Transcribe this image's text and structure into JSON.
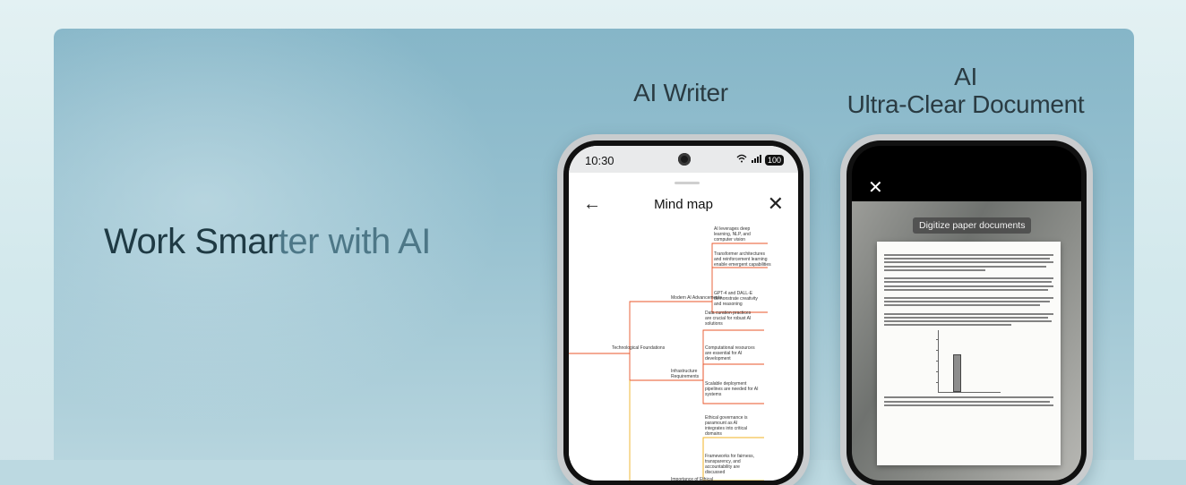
{
  "banner": {
    "headline_main": "Work Smar",
    "headline_accent": "ter with AI"
  },
  "features": [
    {
      "label": "AI Writer"
    },
    {
      "label_line1": "AI",
      "label_line2": "Ultra-Clear Document"
    }
  ],
  "phone_writer": {
    "status_time": "10:30",
    "battery": "100",
    "screen_title": "Mind map",
    "back_icon": "arrow-left-icon",
    "close_icon": "close-icon",
    "mind_map": {
      "root": "Technological Foundations",
      "branches": [
        {
          "label": "Modern AI Advancements",
          "leaves": [
            "AI leverages deep learning, NLP, and computer vision",
            "Transformer architectures and reinforcement learning enable emergent capabilities",
            "GPT-4 and DALL-E demonstrate creativity and reasoning"
          ]
        },
        {
          "label": "Infrastructure Requirements",
          "leaves": [
            "Data curation practices are crucial for robust AI solutions",
            "Computational resources are essential for AI development",
            "Scalable deployment pipelines are needed for AI systems"
          ]
        },
        {
          "label": "Importance of Ethical Governance",
          "leaves": [
            "Ethical governance is paramount as AI integrates into critical domains",
            "Frameworks for fairness, transparency, and accountability are discussed"
          ]
        }
      ],
      "colors": {
        "primary": "#e8542a",
        "secondary": "#f0b323"
      }
    }
  },
  "phone_document": {
    "close_icon": "close-icon",
    "chip_label": "Digitize paper documents"
  },
  "colors": {
    "background": "#d8ecef",
    "banner": "#8fbccb",
    "headline": "#1f3a44",
    "headline_accent": "#4d7787"
  }
}
